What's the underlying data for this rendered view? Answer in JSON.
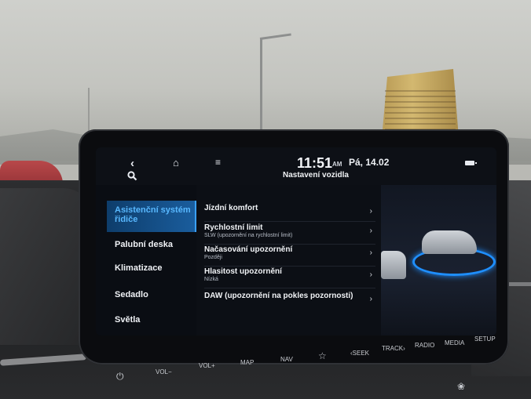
{
  "status_bar": {
    "time": "11:51",
    "ampm": "AM",
    "date": "Pá, 14.02",
    "title": "Nastavení vozidla"
  },
  "left_menu": [
    {
      "label": "Asistenční systém řidiče",
      "active": true
    },
    {
      "label": "Palubní deska",
      "active": false
    },
    {
      "label": "Klimatizace",
      "active": false
    },
    {
      "label": "Sedadlo",
      "active": false
    },
    {
      "label": "Světla",
      "active": false
    }
  ],
  "settings_list": [
    {
      "title": "Jízdní komfort",
      "subtitle": ""
    },
    {
      "title": "Rychlostní limit",
      "subtitle": "SLW (upozornění na rychlostní limit)"
    },
    {
      "title": "Načasování upozornění",
      "subtitle": "Později"
    },
    {
      "title": "Hlasitost upozornění",
      "subtitle": "Nízká"
    },
    {
      "title": "DAW (upozornění na pokles pozornosti)",
      "subtitle": ""
    }
  ],
  "hardware_buttons": {
    "vol_minus": "VOL−",
    "vol_plus": "VOL+",
    "map": "MAP",
    "nav": "NAV",
    "seek": "‹SEEK",
    "track": "TRACK›",
    "radio": "RADIO",
    "media": "MEDIA",
    "setup": "SETUP"
  },
  "icons": {
    "back": "chevron-left-icon",
    "home": "home-icon",
    "menu": "menu-icon",
    "search": "search-icon",
    "power": "power-icon",
    "favorite": "star-icon",
    "fan": "fan-icon",
    "battery": "battery-icon"
  },
  "colors": {
    "accent": "#3aa0ff",
    "active_bg": "#1a5d9d",
    "screen_bg": "#0a0d13"
  }
}
